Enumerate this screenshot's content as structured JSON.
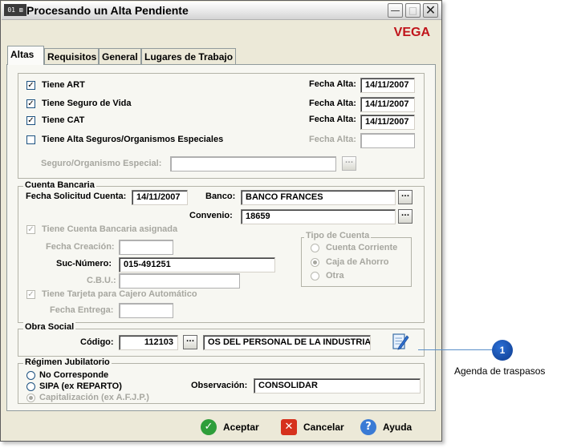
{
  "window": {
    "icon_label": "01 ⊠",
    "title": "Procesando un Alta Pendiente",
    "minimize_symbol": "—",
    "maximize_symbol": "□",
    "close_symbol": "✕",
    "brand": "VEGA",
    "brand_color": "#c0141b"
  },
  "tabs": [
    {
      "label": "Altas",
      "active": true
    },
    {
      "label": "Requisitos",
      "active": false
    },
    {
      "label": "General",
      "active": false
    },
    {
      "label": "Lugares de Trabajo",
      "active": false
    }
  ],
  "altas": {
    "fecha_alta_label": "Fecha Alta:",
    "rows": [
      {
        "label": "Tiene ART",
        "checked": true,
        "date": "14/11/2007"
      },
      {
        "label": "Tiene Seguro de Vida",
        "checked": true,
        "date": "14/11/2007"
      },
      {
        "label": "Tiene CAT",
        "checked": true,
        "date": "14/11/2007"
      },
      {
        "label": "Tiene Alta Seguros/Organismos Especiales",
        "checked": false,
        "date": ""
      }
    ],
    "seguro_label": "Seguro/Organismo Especial:",
    "seguro_value": ""
  },
  "cuenta": {
    "title": "Cuenta Bancaria",
    "fecha_solicitud_label": "Fecha Solicitud Cuenta:",
    "fecha_solicitud_value": "14/11/2007",
    "banco_label": "Banco:",
    "banco_value": "BANCO FRANCES",
    "convenio_label": "Convenio:",
    "convenio_value": "18659",
    "asignada_label": "Tiene Cuenta Bancaria asignada",
    "fecha_creacion_label": "Fecha Creación:",
    "suc_numero_label": "Suc-Número:",
    "suc_numero_value": "015-491251",
    "cbu_label": "C.B.U.:",
    "tarjeta_label": "Tiene Tarjeta para Cajero Automático",
    "fecha_entrega_label": "Fecha Entrega:",
    "tipo_title": "Tipo de Cuenta",
    "tipo_options": [
      "Cuenta Corriente",
      "Caja de Ahorro",
      "Otra"
    ]
  },
  "obra_social": {
    "title": "Obra Social",
    "codigo_label": "Código:",
    "codigo_value": "112103",
    "nombre_value": "OS DEL PERSONAL DE LA INDUSTRIA"
  },
  "regimen": {
    "title": "Régimen Jubilatorio",
    "options": [
      "No Corresponde",
      "SIPA (ex REPARTO)",
      "Capitalización (ex A.F.J.P.)"
    ],
    "observacion_label": "Observación:",
    "observacion_value": "CONSOLIDAR"
  },
  "buttons": {
    "aceptar": "Aceptar",
    "cancelar": "Cancelar",
    "ayuda": "Ayuda",
    "ellipsis": "...",
    "check_symbol": "✓",
    "x_symbol": "✕",
    "help_symbol": "?"
  },
  "callout": {
    "number": "1",
    "text": "Agenda de traspasos"
  }
}
